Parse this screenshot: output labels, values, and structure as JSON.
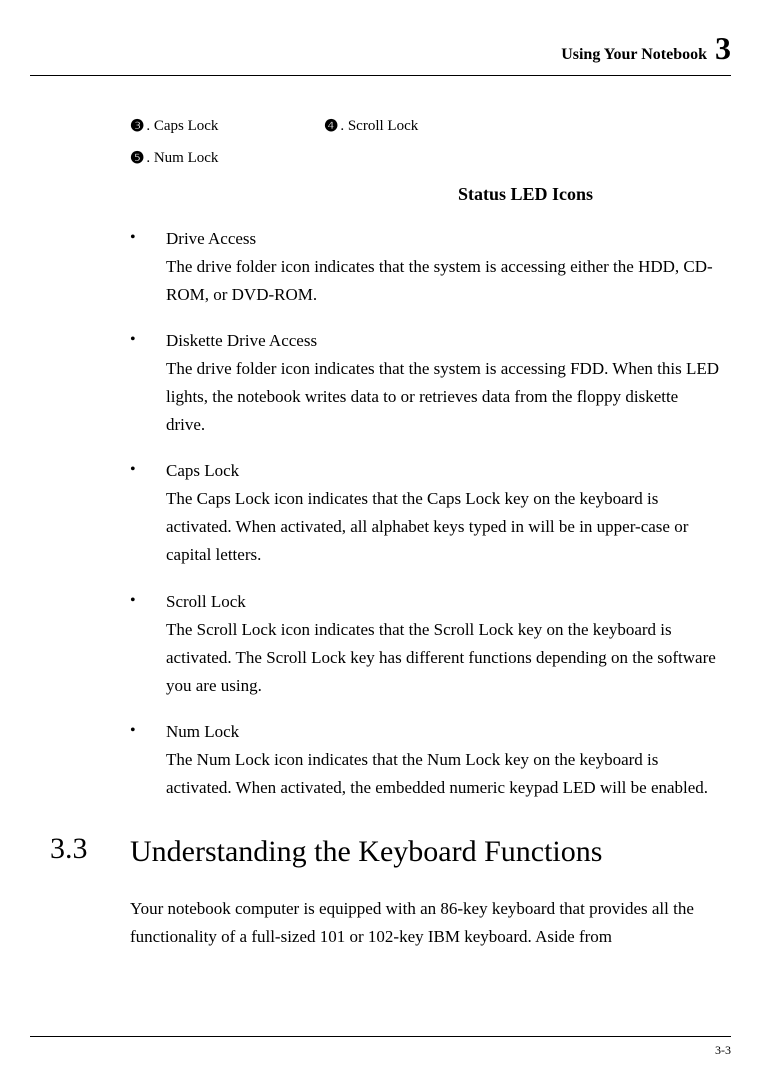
{
  "header": {
    "text": "Using Your Notebook",
    "chapter_number": "3"
  },
  "numbered_items": {
    "item3": {
      "num": "❸",
      "label": ". Caps Lock"
    },
    "item4": {
      "num": "❹",
      "label": ". Scroll Lock"
    },
    "item5": {
      "num": "❺",
      "label": ". Num Lock"
    }
  },
  "table_title": "Status LED Icons",
  "bullets": [
    {
      "title": "Drive Access",
      "desc": "The drive folder icon indicates that the system is accessing either the HDD, CD-ROM, or DVD-ROM."
    },
    {
      "title": "Diskette Drive Access",
      "desc": "The drive folder icon indicates that the system is accessing FDD. When this LED lights, the notebook writes data to or retrieves data from the floppy diskette drive."
    },
    {
      "title": "Caps Lock",
      "desc": "The Caps Lock icon indicates that the Caps Lock key on the keyboard is activated. When activated, all alphabet keys typed in will be in upper-case or capital letters."
    },
    {
      "title": "Scroll Lock",
      "desc": "The Scroll Lock icon indicates that the Scroll Lock key on the keyboard is activated. The Scroll Lock key has different functions depending on the software you are using."
    },
    {
      "title": "Num Lock",
      "desc": "The Num Lock icon indicates that the Num Lock key on the keyboard is activated. When activated, the embedded numeric keypad LED will be enabled."
    }
  ],
  "section": {
    "number": "3.3",
    "title": "Understanding the Keyboard Functions",
    "body": "Your notebook computer is equipped with an 86-key keyboard that provides all the functionality of a full-sized 101 or 102-key IBM keyboard. Aside from"
  },
  "page_number": "3-3"
}
